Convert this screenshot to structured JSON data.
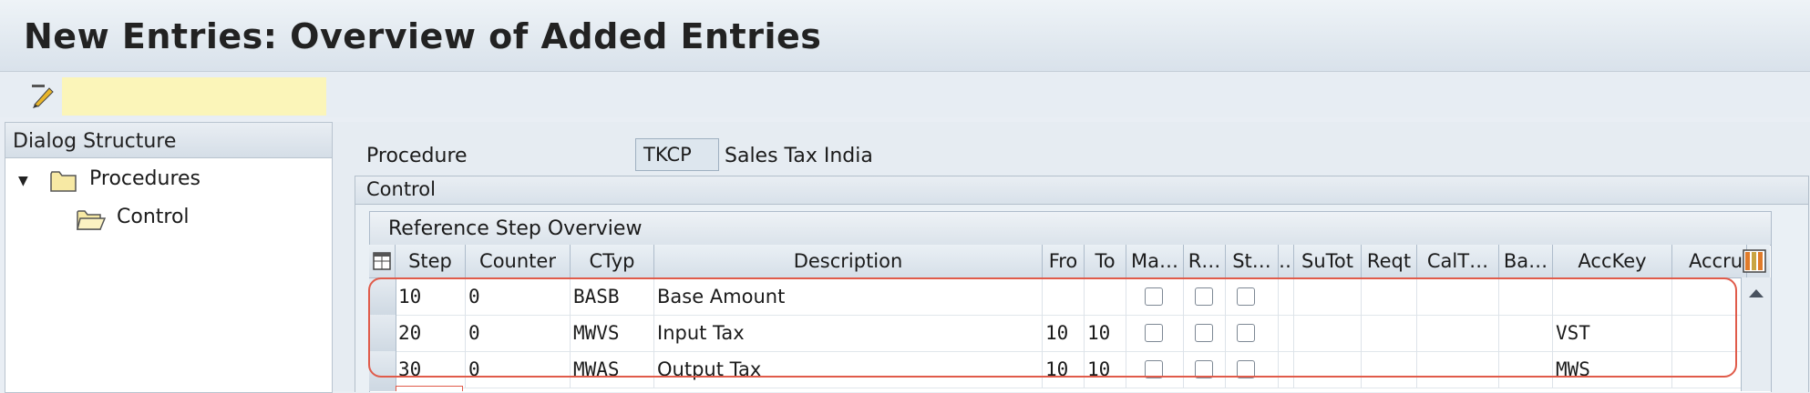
{
  "window": {
    "title": "New Entries: Overview of Added Entries"
  },
  "toolbar": {
    "icons": [
      "change-display-icon",
      "delete-row-icon",
      "select-all-icon",
      "select-block-icon",
      "deselect-all-icon"
    ]
  },
  "dialog_structure": {
    "header": "Dialog Structure",
    "items": [
      {
        "label": "Procedures",
        "expanded": true,
        "icon": "folder-icon"
      },
      {
        "label": "Control",
        "selected": true,
        "icon": "open-folder-icon"
      }
    ]
  },
  "procedure": {
    "label": "Procedure",
    "value": "TKCP",
    "description": "Sales Tax India"
  },
  "control": {
    "header": "Control",
    "table_title": "Reference Step Overview",
    "columns": [
      "Step",
      "Counter",
      "CTyp",
      "Description",
      "Fro",
      "To",
      "Ma…",
      "R…",
      "St…",
      "…",
      "SuTot",
      "Reqt",
      "CalT…",
      "Ba…",
      "AccKey",
      "Accru"
    ],
    "rows": [
      {
        "step": "10",
        "counter": "0",
        "ctyp": "BASB",
        "description": "Base Amount",
        "from": "",
        "to": "",
        "acckey": ""
      },
      {
        "step": "20",
        "counter": "0",
        "ctyp": "MWVS",
        "description": "Input Tax",
        "from": "10",
        "to": "10",
        "acckey": "VST"
      },
      {
        "step": "30",
        "counter": "0",
        "ctyp": "MWAS",
        "description": "Output Tax",
        "from": "10",
        "to": "10",
        "acckey": "MWS"
      }
    ]
  },
  "colors": {
    "highlight": "#e05b4a",
    "selected_tree": "#fbf5b9"
  }
}
